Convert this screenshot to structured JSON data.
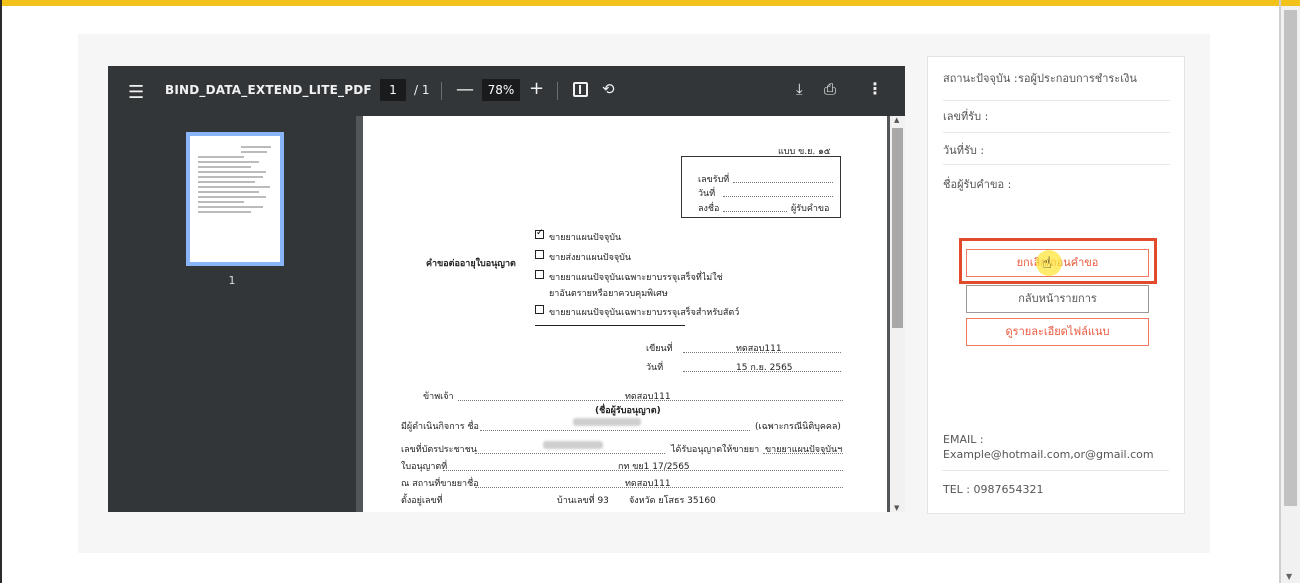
{
  "viewer": {
    "title": "BIND_DATA_EXTEND_LITE_PDF",
    "page_current": "1",
    "page_sep": "/ 1",
    "zoom": "78%",
    "thumbnail_number": "1"
  },
  "document": {
    "form_code": "แบบ ข.ย. ๑๕",
    "receipt_no_label": "เลขรับที่",
    "date_label": "วันที่",
    "sign_label": "ลงชื่อ",
    "receiver_label": "ผู้รับคำขอ",
    "request_title": "คำขอต่ออายุใบอนุญาต",
    "options": [
      {
        "text": "ขายยาแผนปัจจุบัน",
        "checked": true
      },
      {
        "text": "ขายส่งยาแผนปัจจุบัน",
        "checked": false
      },
      {
        "text": "ขายยาแผนปัจจุบันเฉพาะยาบรรจุเสร็จที่ไม่ใช่",
        "checked": false
      },
      {
        "text": "ยาอันตรายหรือยาควบคุมพิเศษ",
        "checked": false
      },
      {
        "text": "ขายยาแผนปัจจุบันเฉพาะยาบรรจุเสร็จสำหรับสัตว์",
        "checked": false
      }
    ],
    "written_at_label": "เขียนที่",
    "written_at_value": "ทดสอบ111",
    "date2_label": "วันที่",
    "date2_value": "15 ก.ย. 2565",
    "i_label": "ข้าพเจ้า",
    "i_value": "ทดสอบ111",
    "licensee_caption": "(ชื่อผู้รับอนุญาต)",
    "operator_label": "มีผู้ดำเนินกิจการ ชื่อ",
    "juristic_note": "(เฉพาะกรณีนิติบุคคล)",
    "id_card_label": "เลขที่บัตรประชาชน",
    "licensed_sell_label": "ได้รับอนุญาตให้ขายยา",
    "licensed_sell_value": "ขายยาแผนปัจจุบันฯ",
    "license_no_label": "ใบอนุญาตที่",
    "license_no_value": "กท ขย1 17/2565",
    "place_label": "ณ สถานที่ขายยาชื่อ",
    "place_value": "ทดสอบ111",
    "located_label": "ตั้งอยู่เลขที่",
    "house_no_label": "บ้านเลขที่ 93",
    "province_value": "จังหวัด ยโสธร 35160"
  },
  "info": {
    "status_label": "สถานะปัจจุบัน :",
    "status_value": "รอผู้ประกอบการชำระเงิน",
    "receipt_no_label": "เลขที่รับ :",
    "receipt_date_label": "วันที่รับ :",
    "receiver_label": "ชื่อผู้รับคำขอ :",
    "btn_cancel": "ยกเลิก/ถอนคำขอ",
    "btn_back": "กลับหน้ารายการ",
    "btn_attach": "ดูรายละเอียดไฟล์แนบ",
    "email_label": "EMAIL :",
    "email_value": "Example@hotmail.com,or@gmail.com",
    "tel": "TEL : 0987654321"
  },
  "colors": {
    "accent_bar": "#f2c21b",
    "highlight": "#e14a2b",
    "button_orange": "#e8583d"
  }
}
